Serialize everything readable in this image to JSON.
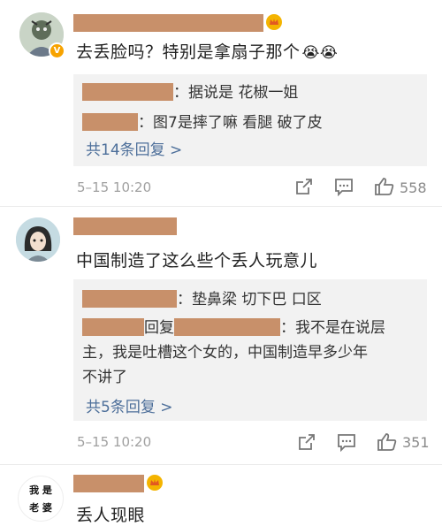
{
  "comments": [
    {
      "text": "去丢脸吗？特别是拿扇子那个",
      "emoji": "😭😭",
      "replies": [
        {
          "text": "：据说是 花椒一姐"
        },
        {
          "text": "：图7是摔了嘛 看腿 破了皮"
        }
      ],
      "more_label": "共14条回复 >",
      "time": "5–15 10:20",
      "likes": "558",
      "vip_badge": "V"
    },
    {
      "text": "中国制造了这么些个丢人玩意儿",
      "replies": [
        {
          "text": "：垫鼻梁 切下巴 口区"
        },
        {
          "reply_word": "回复",
          "line1": "：我不是在说层",
          "line2": "主，我是吐槽这个女的，中国制造早多少年",
          "line3": "不讲了"
        }
      ],
      "more_label": "共5条回复 >",
      "time": "5–15 10:20",
      "likes": "351"
    },
    {
      "text": "丢人现眼",
      "avatar_text_1": "我 是",
      "avatar_text_2": "老 婆"
    }
  ],
  "colors": {
    "redaction": "#c8906a",
    "link": "#4d6f9a",
    "reply_bg": "#f2f2f2",
    "meta": "#a0a0a0"
  },
  "icons": [
    "share-icon",
    "comment-icon",
    "like-icon",
    "crown-icon",
    "vip-badge-icon"
  ]
}
